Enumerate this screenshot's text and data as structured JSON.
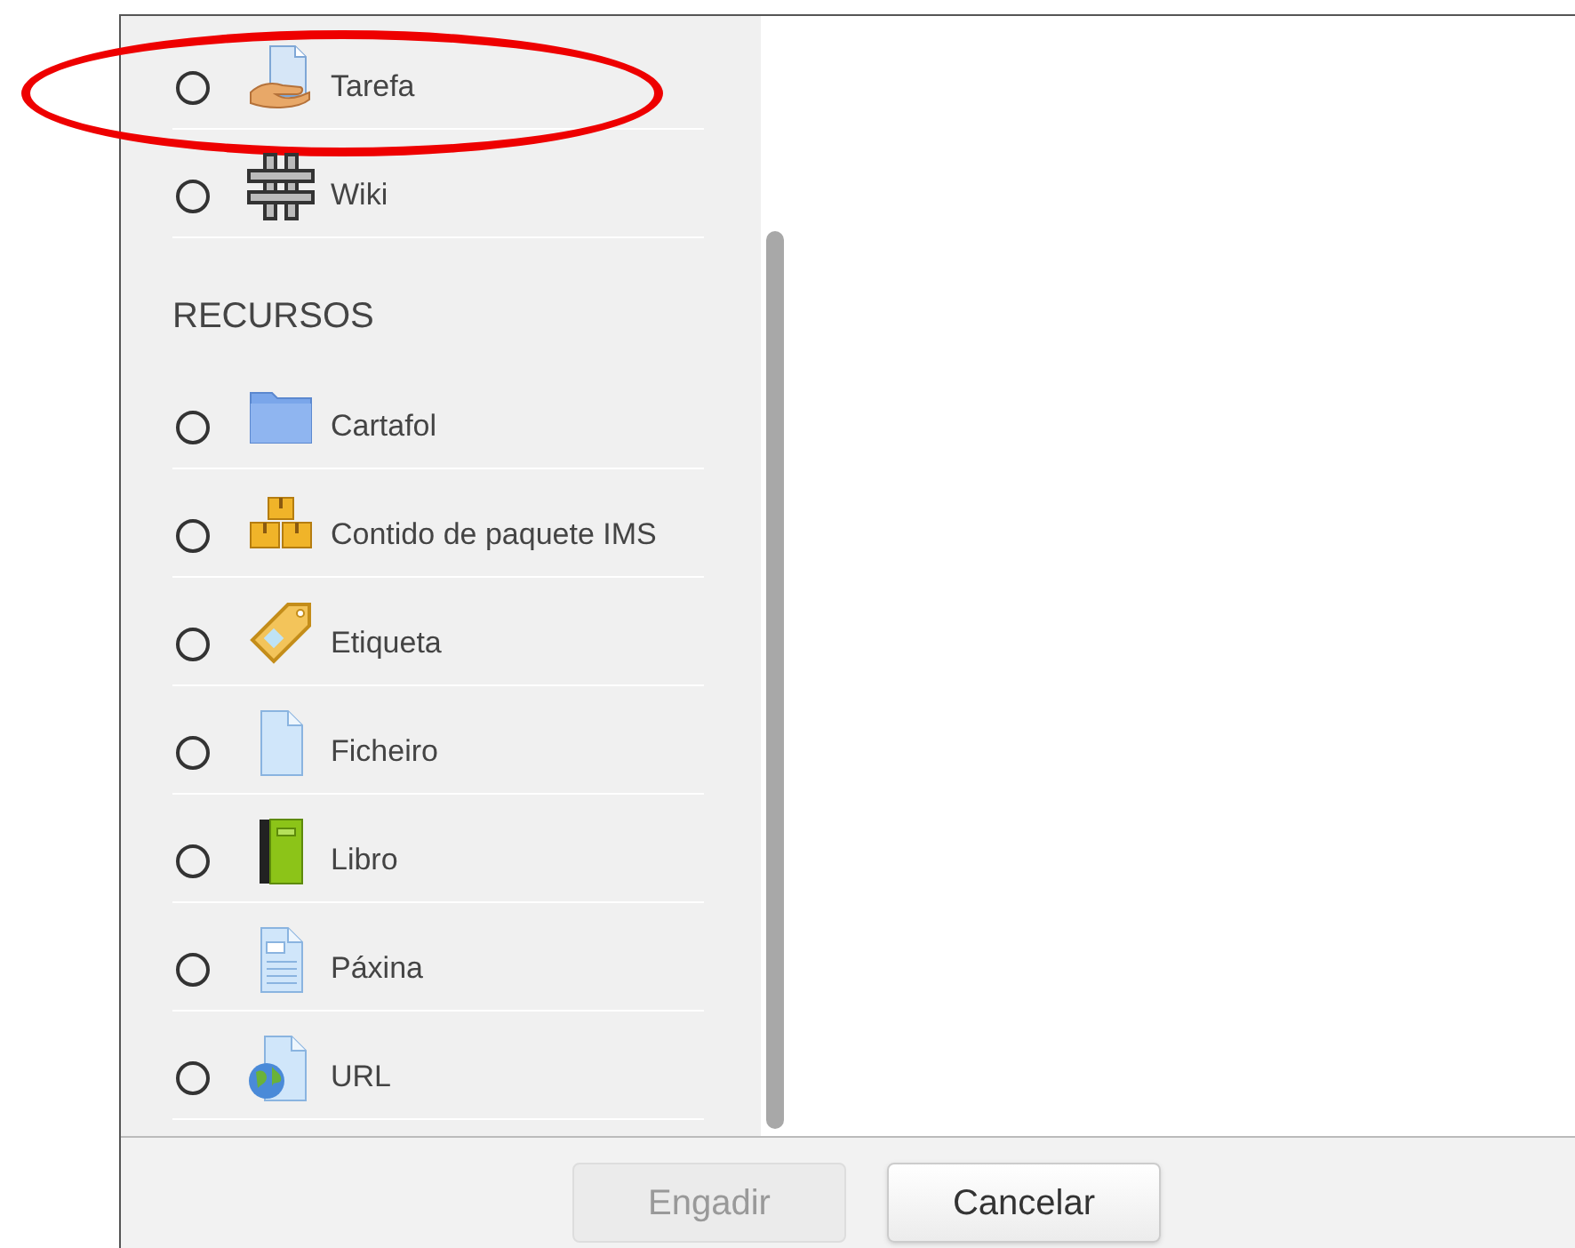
{
  "activities": [
    {
      "label": "Tarefa",
      "kind": "assignment",
      "selected": false,
      "highlighted": true
    },
    {
      "label": "Wiki",
      "kind": "wiki",
      "selected": false,
      "highlighted": false
    }
  ],
  "section_heading": "RECURSOS",
  "resources": [
    {
      "label": "Cartafol",
      "kind": "folder",
      "selected": false,
      "highlighted": false
    },
    {
      "label": "Contido de paquete IMS",
      "kind": "boxes",
      "selected": false,
      "highlighted": false
    },
    {
      "label": "Etiqueta",
      "kind": "tag",
      "selected": false,
      "highlighted": false
    },
    {
      "label": "Ficheiro",
      "kind": "file",
      "selected": false,
      "highlighted": false
    },
    {
      "label": "Libro",
      "kind": "book",
      "selected": false,
      "highlighted": false
    },
    {
      "label": "Páxina",
      "kind": "page",
      "selected": false,
      "highlighted": false
    },
    {
      "label": "URL",
      "kind": "url",
      "selected": false,
      "highlighted": false
    }
  ],
  "buttons": [
    {
      "label": "Engadir",
      "disabled": true
    },
    {
      "label": "Cancelar",
      "disabled": false
    }
  ]
}
